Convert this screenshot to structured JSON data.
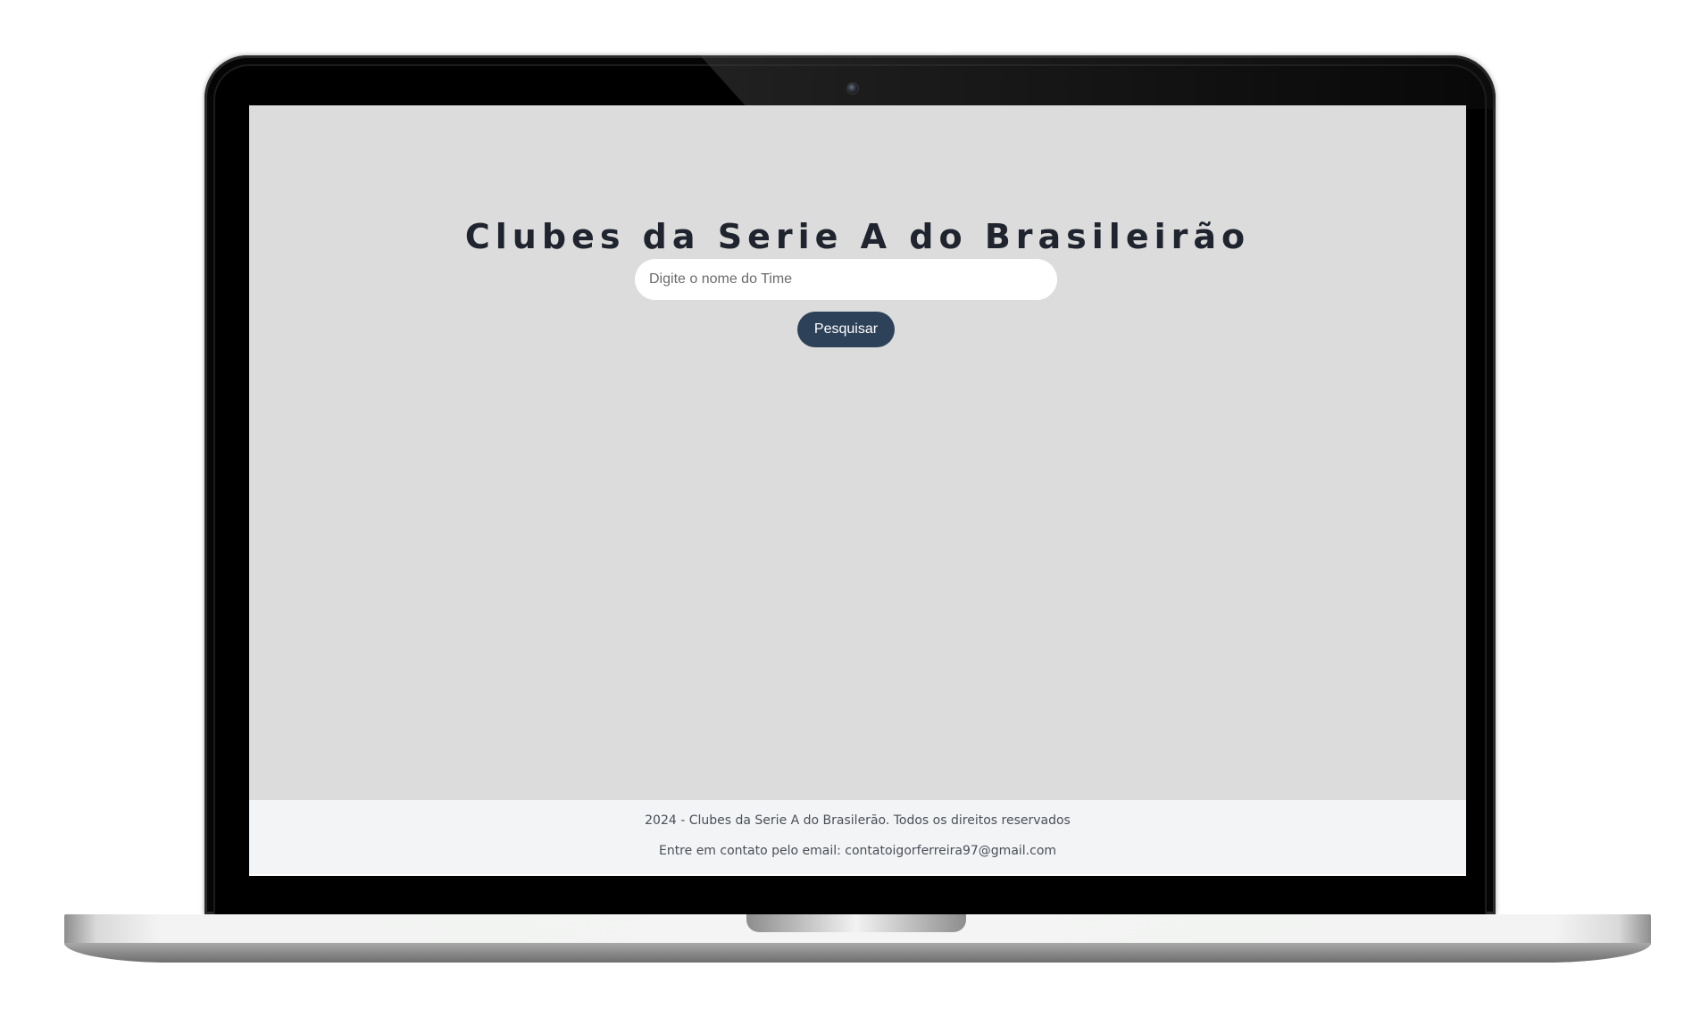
{
  "page": {
    "title": "Clubes da Serie A do Brasileirão"
  },
  "search": {
    "placeholder": "Digite o nome do Time",
    "value": "",
    "button_label": "Pesquisar"
  },
  "footer": {
    "copyright": "2024 - Clubes da Serie A do Brasilerão. Todos os direitos reservados",
    "contact": "Entre em contato pelo email: contatoigorferreira97@gmail.com"
  },
  "colors": {
    "background": "#dcdcdc",
    "title": "#20242e",
    "button": "#2d4258",
    "footer_bg": "#f3f4f6"
  },
  "icons": {
    "camera": "webcam-icon"
  }
}
